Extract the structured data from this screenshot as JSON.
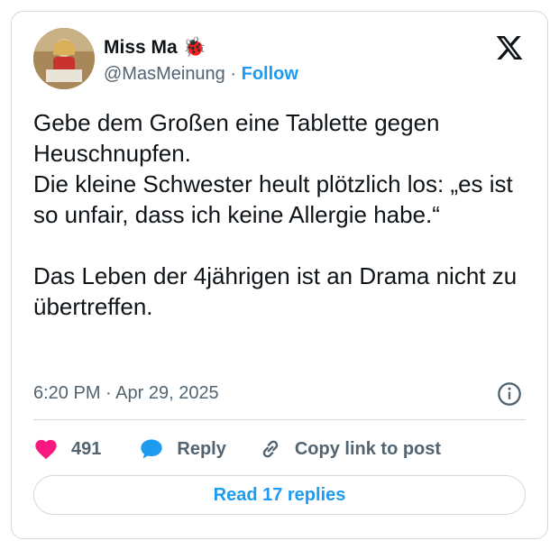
{
  "author": {
    "display_name": "Miss Ma 🐞",
    "handle": "@MasMeinung",
    "separator": "·",
    "follow_label": "Follow"
  },
  "tweet": {
    "lines": [
      "Gebe dem Großen eine Tablette gegen Heuschnupfen.",
      "Die kleine Schwester heult plötzlich los: „es ist so unfair, dass ich keine Allergie habe.“",
      "Das Leben der 4jährigen ist an Drama nicht zu übertreffen."
    ],
    "timestamp": "6:20 PM · Apr 29, 2025"
  },
  "actions": {
    "like_count": "491",
    "reply_label": "Reply",
    "copy_label": "Copy link to post"
  },
  "read_replies_label": "Read 17 replies",
  "colors": {
    "accent": "#1d9bf0",
    "like": "#f91880",
    "text": "#0f1419",
    "muted": "#536471",
    "border": "#cfd9de"
  },
  "icons": [
    "x-logo-icon",
    "info-icon",
    "heart-icon",
    "reply-bubble-icon",
    "link-icon"
  ]
}
